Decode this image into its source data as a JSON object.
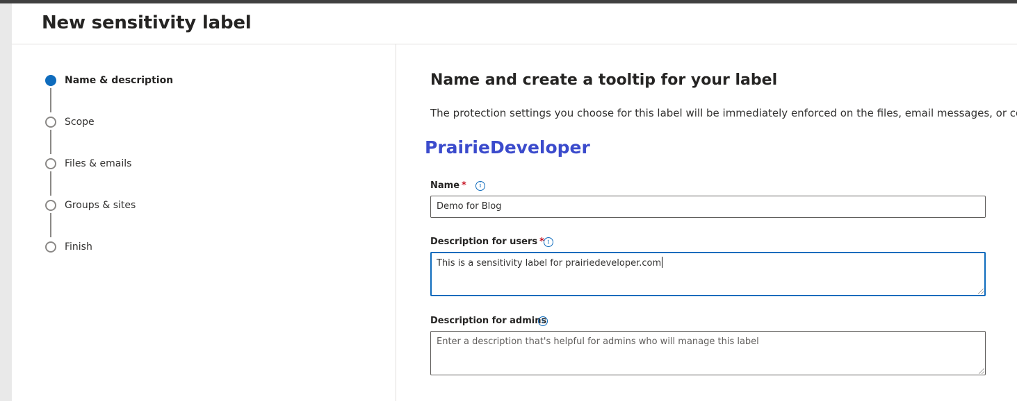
{
  "page": {
    "title": "New sensitivity label"
  },
  "wizard": {
    "steps": [
      {
        "label": "Name & description",
        "state": "current"
      },
      {
        "label": "Scope",
        "state": "pending"
      },
      {
        "label": "Files & emails",
        "state": "pending"
      },
      {
        "label": "Groups & sites",
        "state": "pending"
      },
      {
        "label": "Finish",
        "state": "pending"
      }
    ]
  },
  "main": {
    "title": "Name and create a tooltip for your label",
    "description": "The protection settings you choose for this label will be immediately enforced on the files, email messages, or content co",
    "watermark": "PrairieDeveloper"
  },
  "form": {
    "name": {
      "label": "Name",
      "required_marker": "*",
      "value": "Demo for Blog",
      "info_icon": "info-icon"
    },
    "description_users": {
      "label": "Description for users",
      "required_marker": "*",
      "value": "This is a sensitivity label for prairiedeveloper.com",
      "info_icon": "info-icon"
    },
    "description_admins": {
      "label": "Description for admins",
      "placeholder": "Enter a description that's helpful for admins who will manage this label",
      "value": "",
      "info_icon": "info-icon"
    }
  },
  "colors": {
    "accent": "#0f6cbd",
    "required": "#c50f1f",
    "watermark": "#3b4bcc",
    "topbar": "#404040"
  }
}
